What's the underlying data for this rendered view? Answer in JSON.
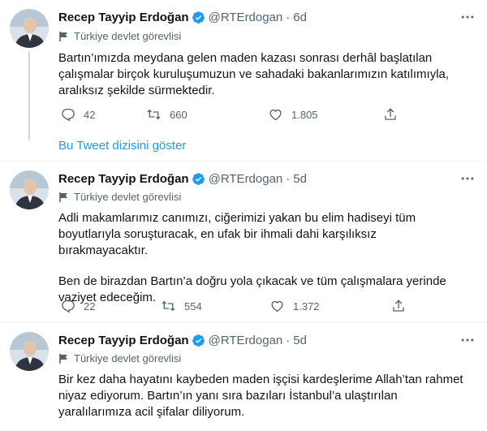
{
  "tweets": [
    {
      "name": "Recep Tayyip Erdoğan",
      "handle": "@RTErdogan",
      "dot": "·",
      "time": "6d",
      "label": "Türkiye devlet görevlisi",
      "paragraphs": [
        "Bartın’ımızda meydana gelen maden kazası sonrası derhâl başlatılan çalışmalar birçok kuruluşumuzun ve sahadaki bakanlarımızın katılımıyla, aralıksız şekilde sürmektedir."
      ],
      "replies": "42",
      "retweets": "660",
      "likes": "1.805"
    },
    {
      "name": "Recep Tayyip Erdoğan",
      "handle": "@RTErdogan",
      "dot": "·",
      "time": "5d",
      "label": "Türkiye devlet görevlisi",
      "paragraphs": [
        "Adli makamlarımız canımızı, ciğerimizi yakan bu elim hadiseyi tüm boyutlarıyla soruşturacak, en ufak bir ihmali dahi karşılıksız bırakmayacaktır.",
        "Ben de birazdan Bartın’a doğru yola çıkacak ve tüm çalışmalara yerinde vaziyet edeceğim."
      ],
      "replies": "22",
      "retweets": "554",
      "likes": "1.372"
    },
    {
      "name": "Recep Tayyip Erdoğan",
      "handle": "@RTErdogan",
      "dot": "·",
      "time": "5d",
      "label": "Türkiye devlet görevlisi",
      "paragraphs": [
        "Bir kez daha hayatını kaybeden maden işçisi kardeşlerime Allah’tan rahmet niyaz ediyorum. Bartın’ın yanı sıra bazıları İstanbul’a ulaştırılan yaralılarımıza acil şifalar diliyorum."
      ]
    }
  ],
  "show_thread": "Bu Tweet dizisini göster",
  "colors": {
    "accent": "#1d9bf0",
    "secondary_text": "#536471",
    "divider": "#eff3f4"
  },
  "icons": {
    "verified": "verified-badge-icon",
    "more": "more-options-icon",
    "label": "government-flag-icon",
    "reply": "reply-icon",
    "retweet": "retweet-icon",
    "like": "heart-icon",
    "share": "share-icon"
  }
}
